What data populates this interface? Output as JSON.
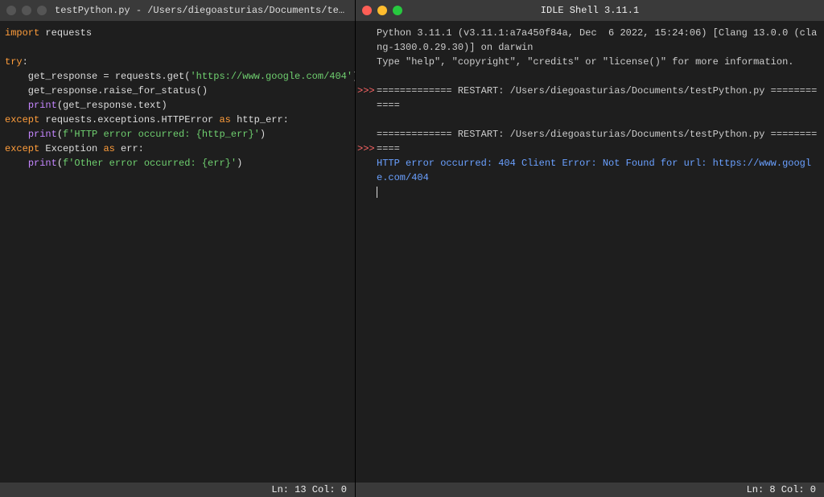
{
  "left_window": {
    "title": "testPython.py - /Users/diegoasturias/Documents/testPython....",
    "status": "Ln: 13  Col: 0",
    "code": {
      "l1_kw": "import",
      "l1_rest": " requests",
      "l3_kw": "try",
      "l3_colon": ":",
      "l4a": "    get_response = requests.get(",
      "l4s": "'https://www.google.com/404'",
      "l4b": ")",
      "l5": "    get_response.raise_for_status()",
      "l6a": "    ",
      "l6p": "print",
      "l6b": "(get_response.text)",
      "l7_kw": "except",
      "l7_mid": " requests.exceptions.HTTPError ",
      "l7_as": "as",
      "l7_end": " http_err:",
      "l8a": "    ",
      "l8p": "print",
      "l8b": "(",
      "l8s": "f'HTTP error occurred: {http_err}'",
      "l8c": ")",
      "l9_kw": "except",
      "l9_mid": " Exception ",
      "l9_as": "as",
      "l9_end": " err:",
      "l10a": "    ",
      "l10p": "print",
      "l10b": "(",
      "l10s": "f'Other error occurred: {err}'",
      "l10c": ")"
    }
  },
  "right_window": {
    "title": "IDLE Shell 3.11.1",
    "status": "Ln: 8  Col: 0",
    "banner1": "Python 3.11.1 (v3.11.1:a7a450f84a, Dec  6 2022, 15:24:06) [Clang 13.0.0 (clang-1300.0.29.30)] on darwin",
    "banner2": "Type \"help\", \"copyright\", \"credits\" or \"license()\" for more information.",
    "restart1": "============= RESTART: /Users/diegoasturias/Documents/testPython.py ============",
    "restart2": "============= RESTART: /Users/diegoasturias/Documents/testPython.py ============",
    "error": "HTTP error occurred: 404 Client Error: Not Found for url: https://www.google.com/404",
    "prompt": ">>>"
  }
}
